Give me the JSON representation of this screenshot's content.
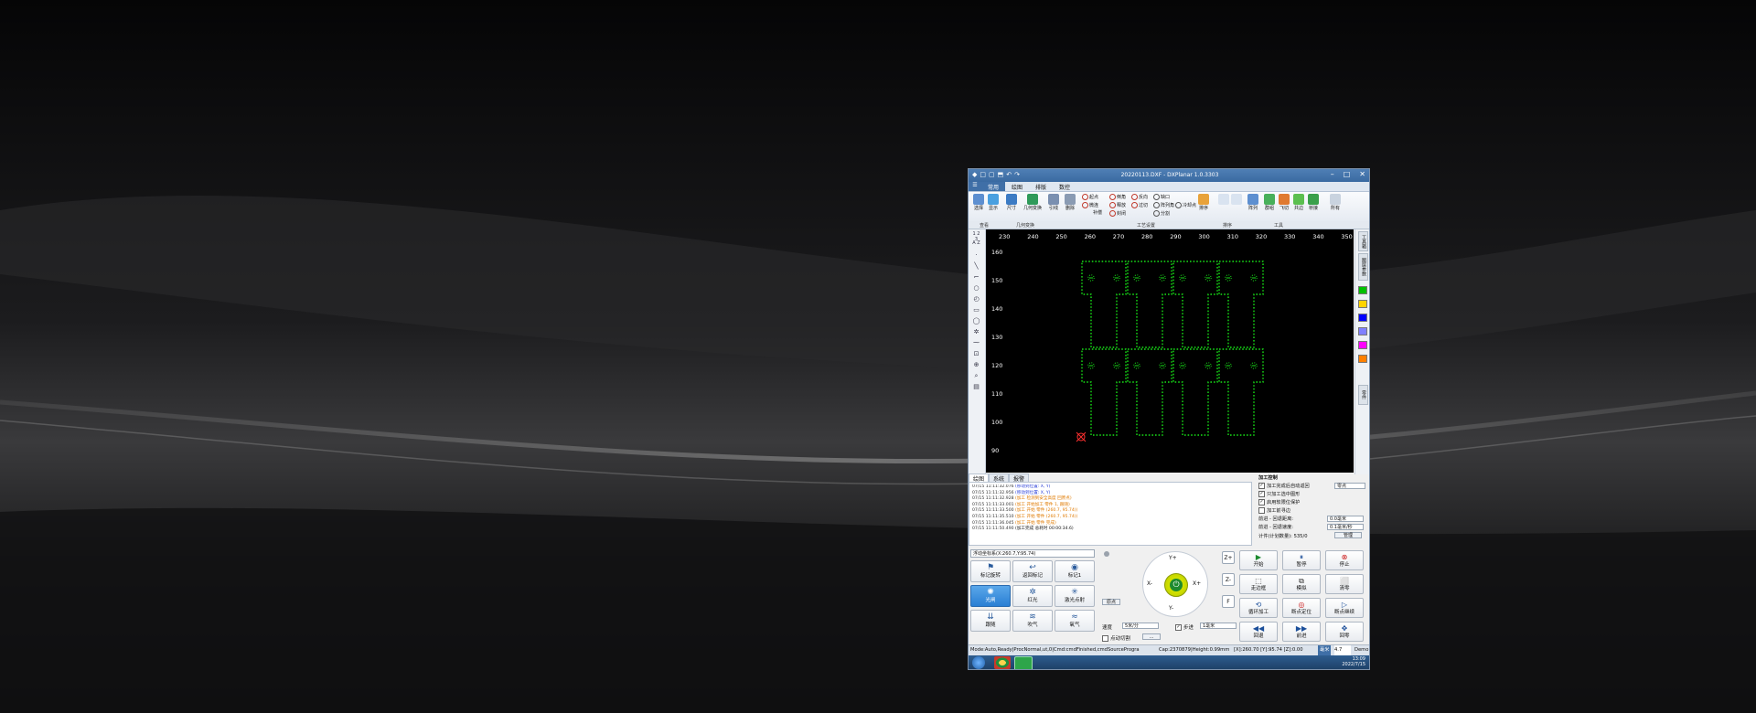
{
  "window": {
    "title": "20220113.DXF - DXPlanar 1.0.3303",
    "quick_access": [
      "□",
      "▢",
      "⬒",
      "↶",
      "↷"
    ],
    "controls": [
      "–",
      "□",
      "✕"
    ]
  },
  "menu": {
    "file_icon": "☰",
    "tabs": [
      "常用",
      "绘图",
      "排版",
      "数控"
    ]
  },
  "ribbon": {
    "big_buttons": [
      "选择",
      "显示",
      "尺寸",
      "几何变换",
      "引线",
      "删除",
      "排序",
      "阵列",
      "群组",
      "飞切",
      "共边",
      "桥接",
      "所有"
    ],
    "small_items": [
      "起点",
      "微连",
      "补偿",
      "倒角",
      "释放",
      "封闭",
      "反向",
      "过切",
      "缺口",
      "阵列角",
      "分割",
      "冷却点"
    ],
    "groups": [
      "查看",
      "几何变换",
      "工艺设置",
      "排序",
      "工具"
    ]
  },
  "canvas": {
    "x_ticks": [
      "230",
      "240",
      "250",
      "260",
      "270",
      "280",
      "290",
      "300",
      "310",
      "320",
      "330",
      "340",
      "350"
    ],
    "y_ticks": [
      "160",
      "150",
      "140",
      "130",
      "120",
      "110",
      "100",
      "90"
    ],
    "side_tools": [
      "1 2 3",
      "A Z",
      "·",
      "╲",
      "⌐",
      "○",
      "◴",
      "▭",
      "◯",
      "✲",
      "⁓",
      "⊡",
      "⊕",
      "⌕",
      "▤"
    ]
  },
  "right_panel": {
    "tabs": [
      "工具箱",
      "图层参数",
      "零件"
    ],
    "layer_colors": [
      "#00c000",
      "#ffd400",
      "#0000ff",
      "#8080ff",
      "#ff00ff",
      "#ff8000"
    ]
  },
  "log": {
    "tabs": [
      "绘图",
      "系统",
      "报警"
    ],
    "lines": [
      {
        "ts": "07/15 11:11:32.076",
        "msg": "(移动到位置: X, Y)",
        "cls": "blue"
      },
      {
        "ts": "07/15 11:11:32.956",
        "msg": "(移动到位置: X, Y)",
        "cls": "blue"
      },
      {
        "ts": "07/15 11:11:32.928",
        "msg": "(加工 检测到安全高度 回原点)",
        "cls": "orange"
      },
      {
        "ts": "07/15 11:11:33.001",
        "msg": "(加工 开始加工 零件 1, 跟随)",
        "cls": "orange"
      },
      {
        "ts": "07/15 11:11:33.500",
        "msg": "(加工 开始 零件 (260.7, 95.74))",
        "cls": "orange"
      },
      {
        "ts": "07/15 11:11:35.510",
        "msg": "(加工 开始 零件 (260.7, 95.74))",
        "cls": "orange"
      },
      {
        "ts": "07/15 11:11:36.045",
        "msg": "(加工 开始 零件 完成)",
        "cls": "orange"
      },
      {
        "ts": "07/15 11:11:50.490",
        "msg": "(加工完成 总耗时 00:00:34.6)",
        "cls": "black"
      }
    ]
  },
  "process": {
    "title": "加工控制",
    "checks": [
      "加工完成后自动返回",
      "只加工选中图形",
      "启用软限位保护",
      "加工前寻边"
    ],
    "return_select": "零点",
    "speed_label": "前进 - 回退距离:",
    "speed_value": "0.0毫米",
    "back_label": "前进 - 回退速度:",
    "back_value": "0.1毫米/秒",
    "count_label": "计件(计划数量): 535/0",
    "manage_btn": "管理"
  },
  "controls": {
    "coord_select": "浮动坐标系(X:260.7,Y:95.74)",
    "buttons": [
      {
        "label": "标记旋转",
        "icon": "⚑",
        "blue": false
      },
      {
        "label": "返回标记",
        "icon": "↩",
        "blue": false
      },
      {
        "label": "标记1",
        "icon": "◉",
        "blue": false
      },
      {
        "label": "光闸",
        "icon": "✺",
        "blue": true
      },
      {
        "label": "红光",
        "icon": "✲",
        "blue": false
      },
      {
        "label": "激光点射",
        "icon": "✳",
        "blue": false
      },
      {
        "label": "跟随",
        "icon": "⇊",
        "blue": false
      },
      {
        "label": "吹气",
        "icon": "≋",
        "blue": false
      },
      {
        "label": "氧气",
        "icon": "≈",
        "blue": false
      }
    ],
    "jog": {
      "up": "Y+",
      "down": "Y-",
      "left": "X-",
      "right": "X+"
    },
    "zbuttons": [
      "Z+",
      "Z-",
      "F"
    ],
    "speed_label": "速度",
    "speed_value": "5米/分",
    "step_check": "步进",
    "step_value": "1毫米",
    "dot_label": "点动切割",
    "more_btn": "...",
    "origin_btn": "原点",
    "side_buttons": [
      {
        "label": "开始",
        "icon": "▶",
        "color": "#1c8a2e"
      },
      {
        "label": "暂停",
        "icon": "⏸",
        "color": "#1c4f9a"
      },
      {
        "label": "停止",
        "icon": "⊗",
        "color": "#cc1c1c"
      },
      {
        "label": "走边框",
        "icon": "⬚",
        "color": "#333"
      },
      {
        "label": "模拟",
        "icon": "⧉",
        "color": "#333"
      },
      {
        "label": "清零",
        "icon": "⬜",
        "color": "#333"
      },
      {
        "label": "循环加工",
        "icon": "⟲",
        "color": "#1c4f9a"
      },
      {
        "label": "断点定位",
        "icon": "◎",
        "color": "#cc1c1c"
      },
      {
        "label": "断点继续",
        "icon": "▷",
        "color": "#1c4f9a"
      },
      {
        "label": "回退",
        "icon": "◀◀",
        "color": "#1c4f9a"
      },
      {
        "label": "前进",
        "icon": "▶▶",
        "color": "#1c4f9a"
      },
      {
        "label": "回零",
        "icon": "✥",
        "color": "#1c4f9a"
      }
    ]
  },
  "status": {
    "mode": "Mode:Auto,Ready|ProcNormal,ut,0|Cmd:cmdFinished,cmdSourceProgra",
    "cap": "Cap:2370879|Height:0.99mm",
    "xy": "[X]:260.70  [Y]:95.74  [Z]:0.00",
    "unit": "毫米",
    "zoom": "4.7",
    "demo": "Demo"
  },
  "taskbar": {
    "time": "13:09",
    "date": "2022/7/15"
  },
  "colors": {
    "accent": "#3f6fa7",
    "path": "#18e018",
    "canvas": "#000000"
  }
}
